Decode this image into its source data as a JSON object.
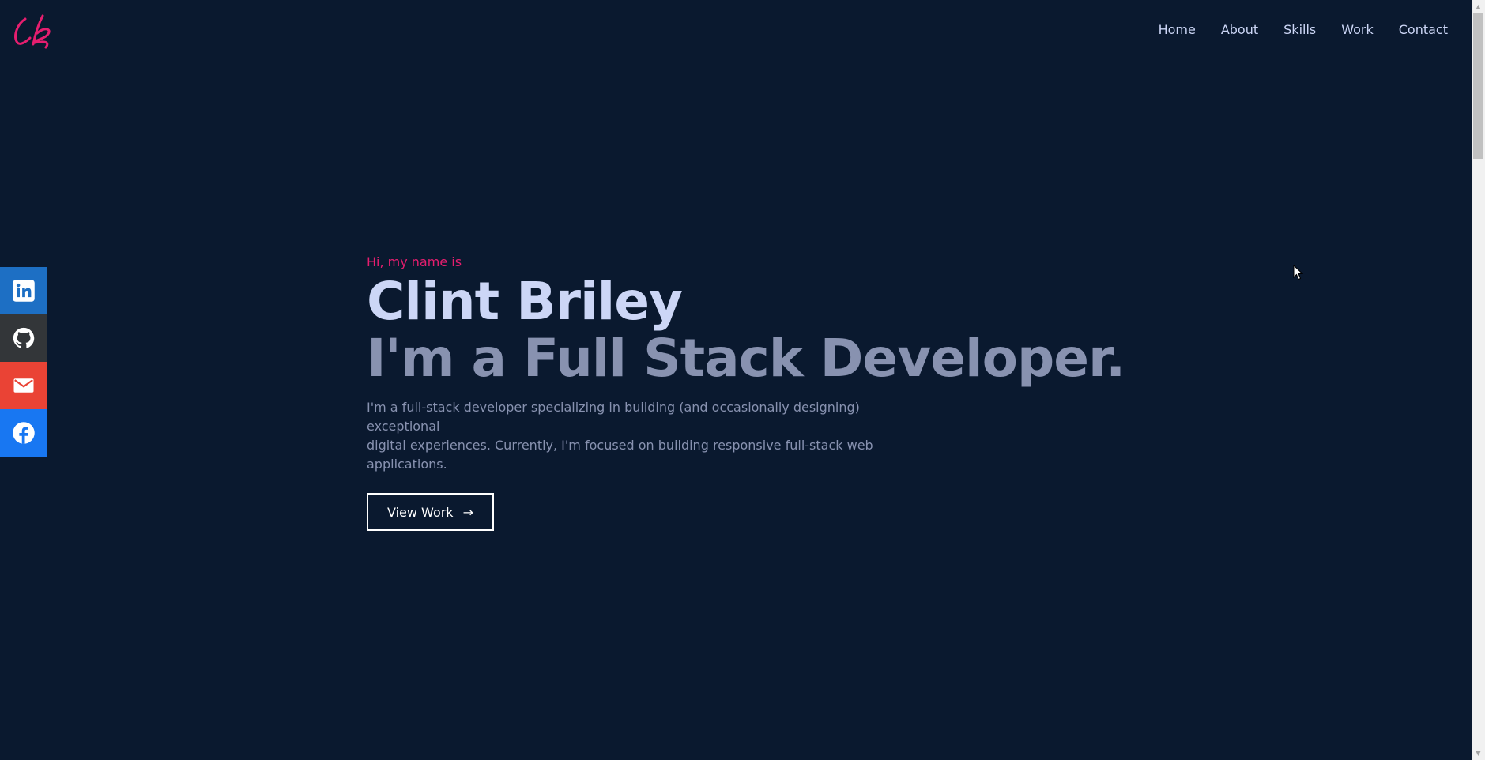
{
  "logo": {
    "text": "Cb"
  },
  "nav": {
    "items": [
      {
        "label": "Home"
      },
      {
        "label": "About"
      },
      {
        "label": "Skills"
      },
      {
        "label": "Work"
      },
      {
        "label": "Contact"
      }
    ]
  },
  "social": {
    "items": [
      {
        "name": "linkedin-icon",
        "color": "#1d6fc4"
      },
      {
        "name": "github-icon",
        "color": "#333639"
      },
      {
        "name": "email-icon",
        "color": "#ea4335"
      },
      {
        "name": "facebook-icon",
        "color": "#1877f2"
      }
    ]
  },
  "hero": {
    "greeting": "Hi, my name is",
    "name": "Clint Briley",
    "tagline": "I'm a Full Stack Developer.",
    "intro_line1": "I'm a full-stack developer specializing in building (and occasionally designing) exceptional",
    "intro_line2": "digital experiences. Currently, I'm focused on building responsive full-stack web applications.",
    "button_label": "View Work",
    "button_icon": "arrow-right-icon"
  },
  "colors": {
    "background": "#0a192f",
    "accent": "#e61e6f",
    "heading": "#ccd6f6",
    "muted": "#8892b0"
  }
}
